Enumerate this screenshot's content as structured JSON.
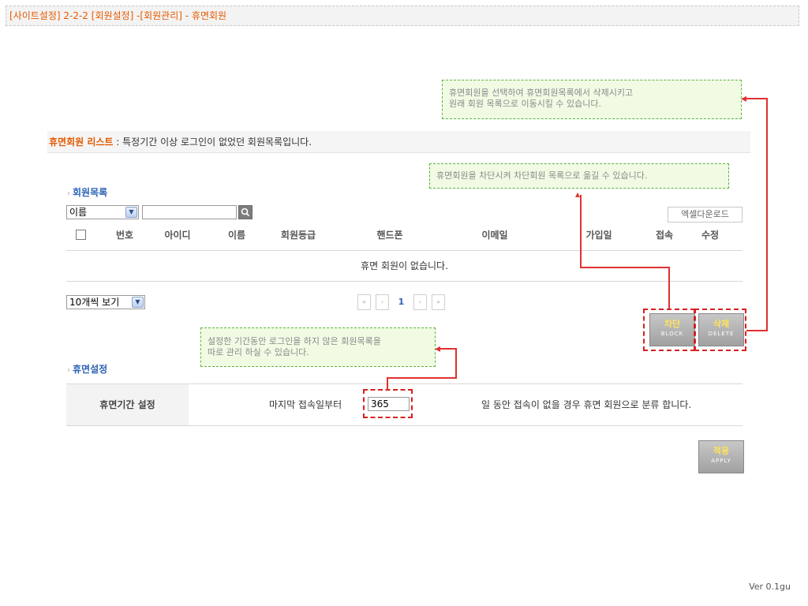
{
  "breadcrumb": "[사이트설정] 2-2-2 [회원설정] -[회원관리] - 휴면회원",
  "notes": {
    "delete_line1": "휴면회원을 선택하여 휴면회원목록에서 삭제시키고",
    "delete_line2": "원래 회원 목록으로 이동시킬 수 있습니다.",
    "block": "휴면회원을 차단시켜 차단회원 목록으로 옮길 수 있습니다.",
    "setting_line1": "설정한 기간동안 로그인을 하지 않은 회원목록을",
    "setting_line2": "따로 관리 하실 수 있습니다."
  },
  "list_header": {
    "title": "휴면회원 리스트",
    "description": " : 특정기간 이상 로그인이 없었던 회원목록입니다."
  },
  "members_section": {
    "title": "회원목록",
    "search_type": "이름",
    "search_placeholder": "",
    "excel_button": "엑셀다운로드",
    "columns": [
      "번호",
      "아이디",
      "이름",
      "회원등급",
      "핸드폰",
      "이메일",
      "가입일",
      "접속",
      "수정"
    ],
    "empty_message": "휴면 회원이 없습니다.",
    "page_size": "10개씩 보기",
    "pagination": {
      "first": "«",
      "prev": "‹",
      "current": "1",
      "next": "›",
      "last": "»"
    }
  },
  "buttons": {
    "block": {
      "label": "차단",
      "sub": "BLOCK"
    },
    "delete": {
      "label": "삭제",
      "sub": "DELETE"
    },
    "apply": {
      "label": "적용",
      "sub": "APPLY"
    }
  },
  "dormant_section": {
    "title": "휴면설정",
    "label": "휴면기간 설정",
    "text_before": "마지막 접속일부터",
    "days_value": "365",
    "text_after": "일 동안 접속이 없을 경우 휴면 회원으로 분류 합니다."
  },
  "version": "Ver 0.1gu",
  "colors": {
    "accent": "#e65a00",
    "section_title": "#2a62b5",
    "note_border": "#5ab43c",
    "annotation_red": "#d82020"
  }
}
